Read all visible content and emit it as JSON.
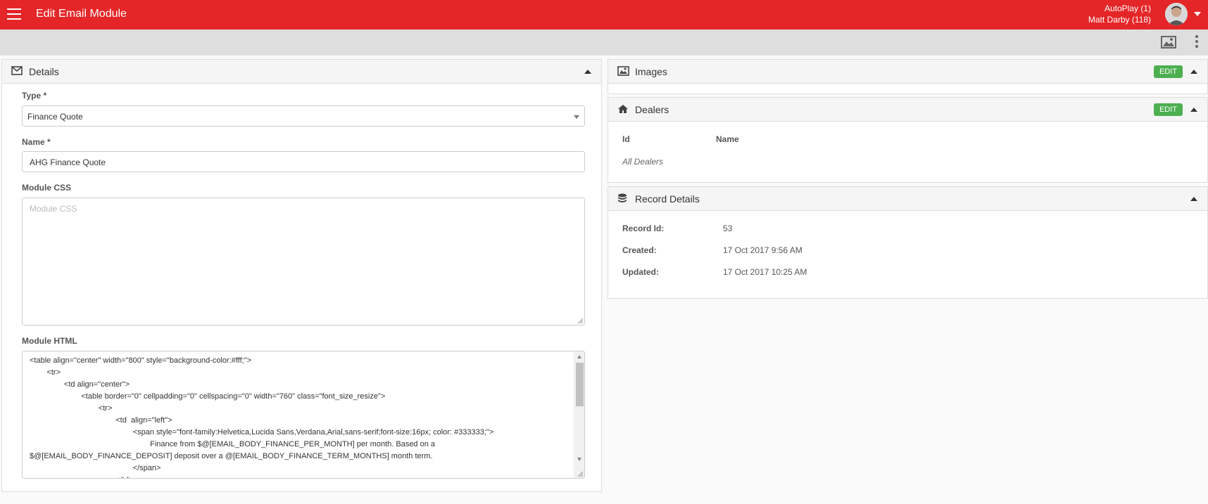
{
  "header": {
    "title": "Edit Email Module",
    "user_line1": "AutoPlay (1)",
    "user_line2": "Matt Darby (118)"
  },
  "details": {
    "title": "Details",
    "type_label": "Type *",
    "type_value": "Finance Quote",
    "name_label": "Name *",
    "name_value": "AHG Finance Quote",
    "css_label": "Module CSS",
    "css_placeholder": "Module CSS",
    "html_label": "Module HTML",
    "html_lines": [
      "<table align=\"center\" width=\"800\" style=\"background-color:#fff;\">",
      "        <tr>",
      "                <td align=\"center\">",
      "                        <table border=\"0\" cellpadding=\"0\" cellspacing=\"0\" width=\"760\" class=\"font_size_resize\">",
      "                                <tr>",
      "                                        <td  align=\"left\">",
      "                                                <span style=\"font-family:Helvetica,Lucida Sans,Verdana,Arial,sans-serif;font-size:16px; color: #333333;\">",
      "                                                        Finance from $@[EMAIL_BODY_FINANCE_PER_MONTH] per month. Based on a",
      "$@[EMAIL_BODY_FINANCE_DEPOSIT] deposit over a @[EMAIL_BODY_FINANCE_TERM_MONTHS] month term.",
      "                                                </span>",
      "                                        </td>"
    ]
  },
  "images": {
    "title": "Images",
    "edit_label": "EDIT"
  },
  "dealers": {
    "title": "Dealers",
    "edit_label": "EDIT",
    "col_id": "Id",
    "col_name": "Name",
    "empty_text": "All Dealers"
  },
  "record": {
    "title": "Record Details",
    "id_label": "Record Id:",
    "id_value": "53",
    "created_label": "Created:",
    "created_value": "17 Oct 2017 9:56 AM",
    "updated_label": "Updated:",
    "updated_value": "17 Oct 2017 10:25 AM"
  },
  "icons": [
    "menu-icon",
    "avatar",
    "image-icon",
    "more-vert-icon",
    "envelope-icon",
    "home-icon",
    "database-icon"
  ],
  "colors": {
    "brand": "#e52628",
    "edit": "#4caf50"
  }
}
